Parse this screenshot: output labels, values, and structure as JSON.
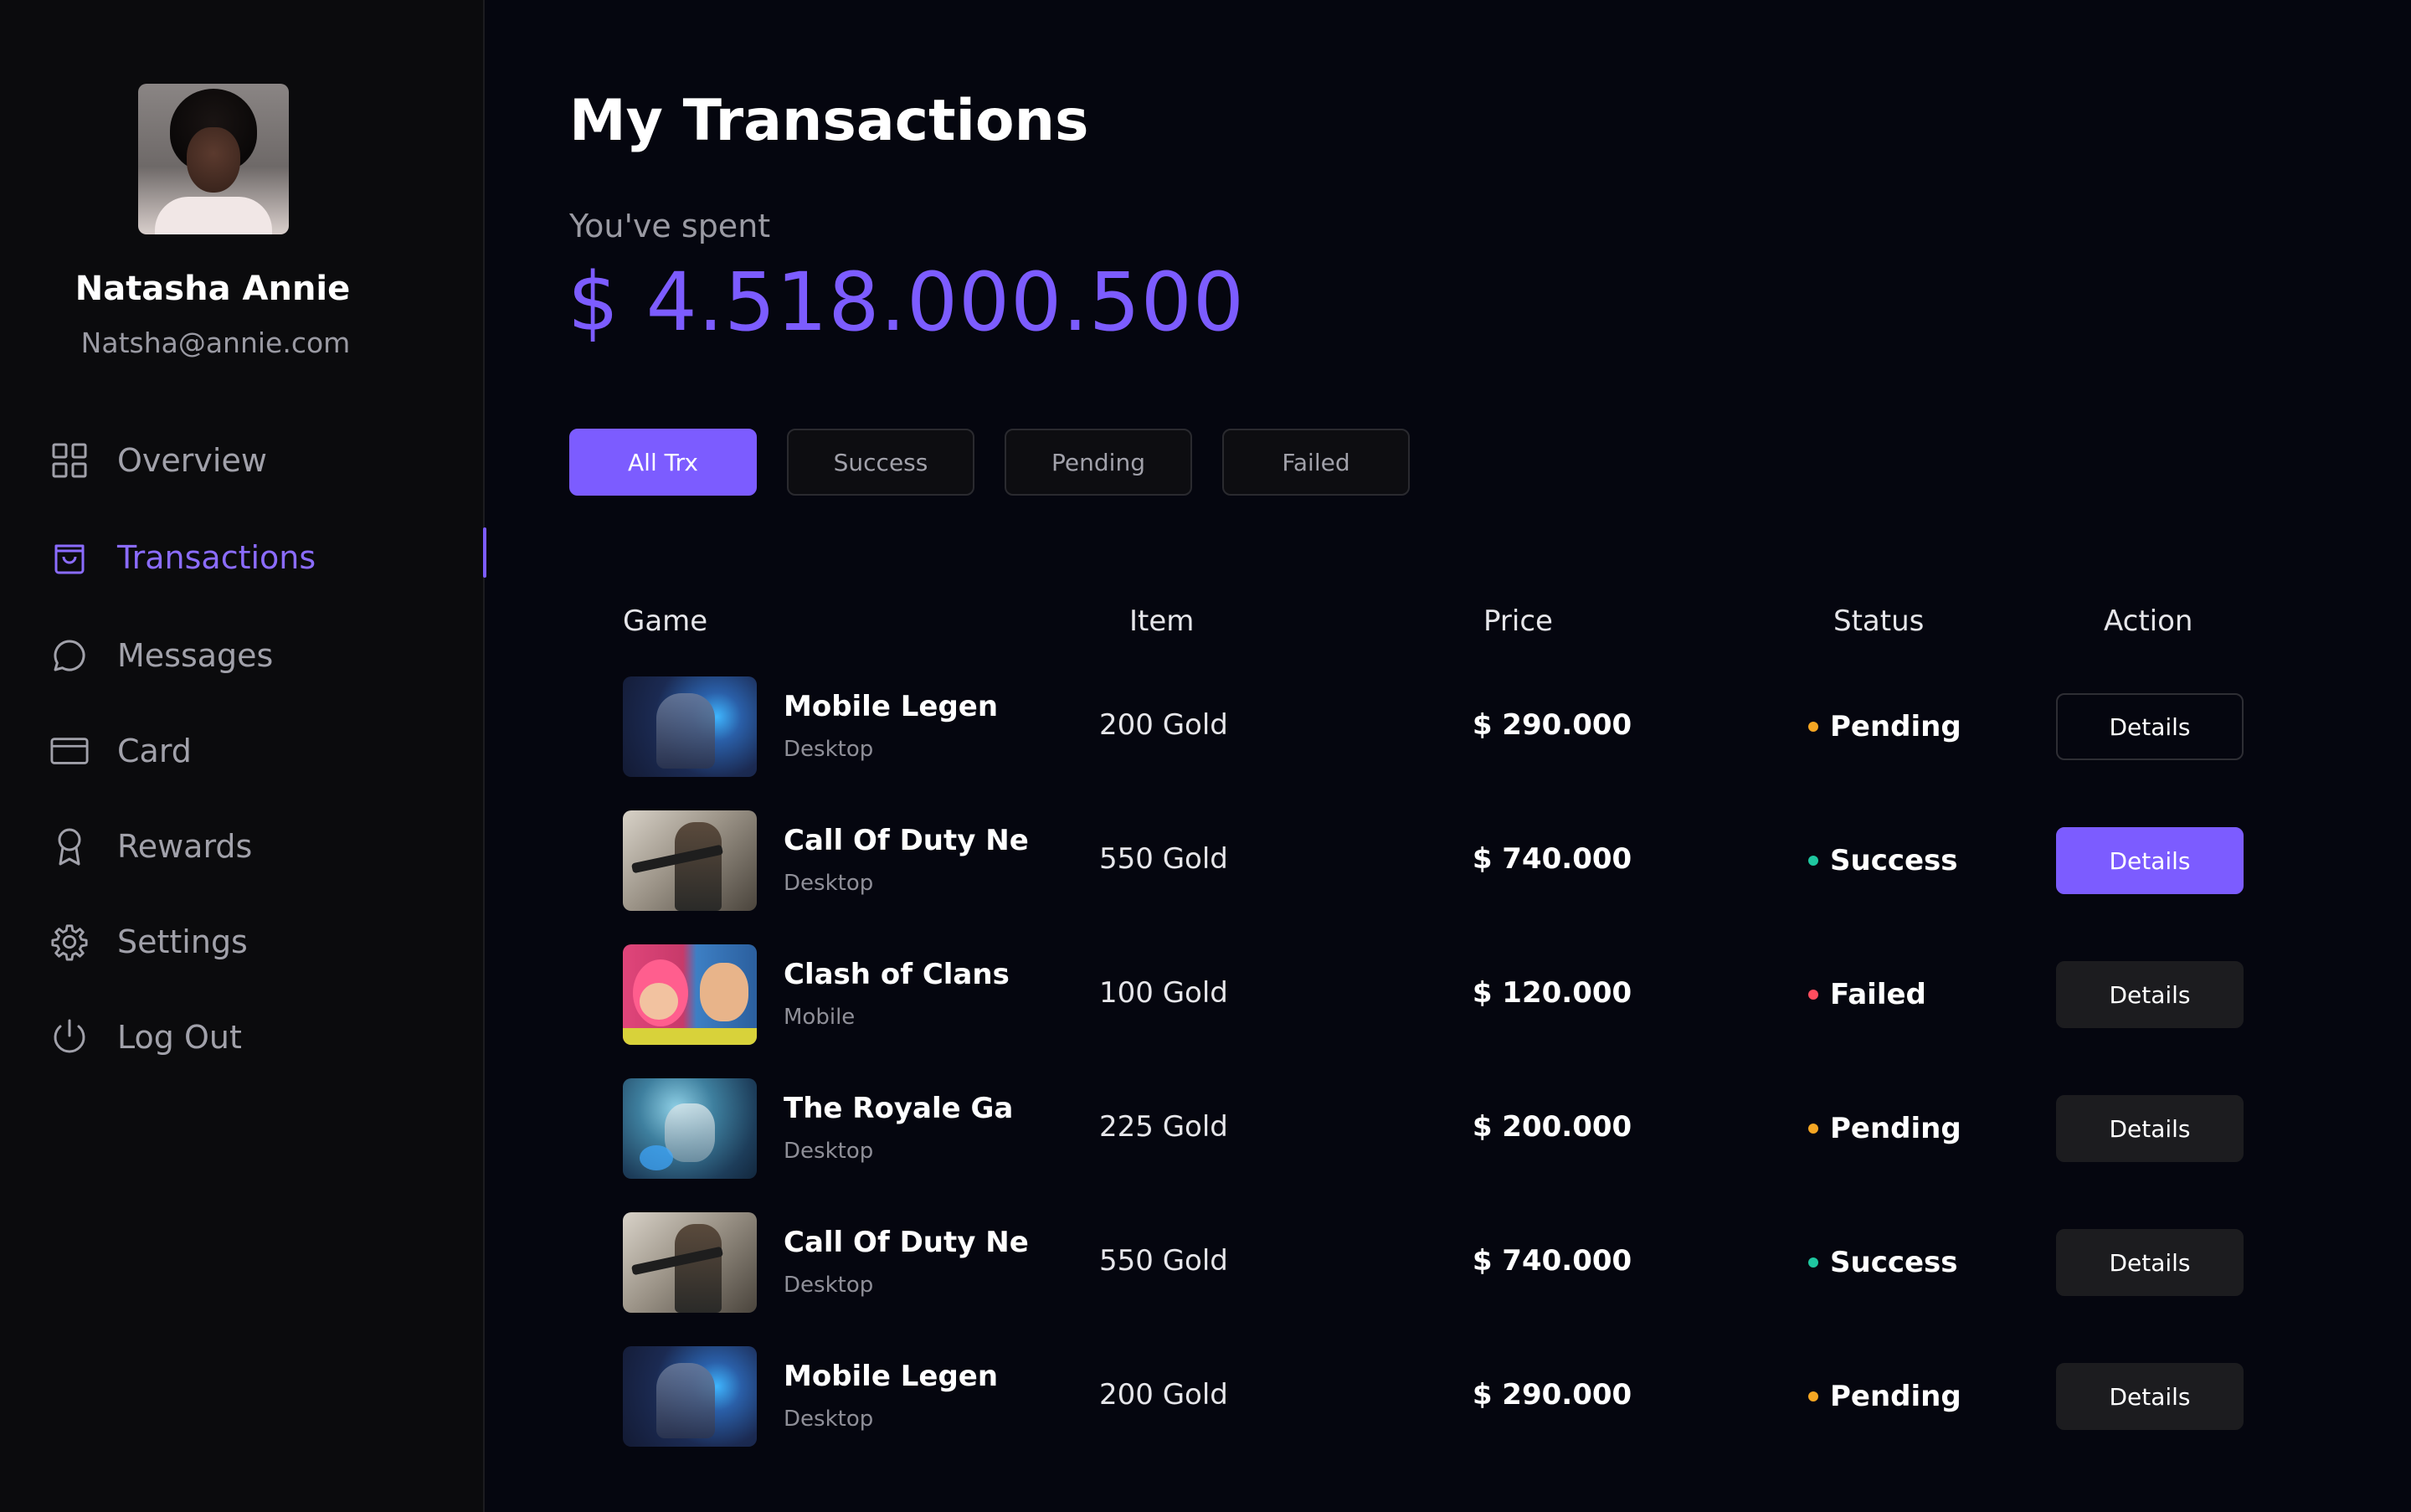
{
  "profile": {
    "name": "Natasha Annie",
    "email": "Natsha@annie.com"
  },
  "nav": {
    "items": [
      {
        "label": "Overview",
        "icon": "grid-icon"
      },
      {
        "label": "Transactions",
        "icon": "bag-icon",
        "active": true
      },
      {
        "label": "Messages",
        "icon": "chat-icon"
      },
      {
        "label": "Card",
        "icon": "card-icon"
      },
      {
        "label": "Rewards",
        "icon": "award-icon"
      },
      {
        "label": "Settings",
        "icon": "gear-icon"
      },
      {
        "label": "Log Out",
        "icon": "power-icon"
      }
    ]
  },
  "main": {
    "title": "My Transactions",
    "spent_label": "You've spent",
    "spent_amount": "$ 4.518.000.500"
  },
  "filters": [
    "All Trx",
    "Success",
    "Pending",
    "Failed"
  ],
  "table": {
    "headers": [
      "Game",
      "Item",
      "Price",
      "Status",
      "Action"
    ],
    "rows": [
      {
        "game": "Mobile Legen",
        "platform": "Desktop",
        "item": "200 Gold",
        "price": "$ 290.000",
        "status": "Pending",
        "action": "Details"
      },
      {
        "game": "Call Of Duty Ne",
        "platform": "Desktop",
        "item": "550 Gold",
        "price": "$ 740.000",
        "status": "Success",
        "action": "Details"
      },
      {
        "game": "Clash of Clans",
        "platform": "Mobile",
        "item": "100 Gold",
        "price": "$ 120.000",
        "status": "Failed",
        "action": "Details"
      },
      {
        "game": "The Royale Ga",
        "platform": "Desktop",
        "item": "225 Gold",
        "price": "$ 200.000",
        "status": "Pending",
        "action": "Details"
      },
      {
        "game": "Call Of Duty Ne",
        "platform": "Desktop",
        "item": "550 Gold",
        "price": "$ 740.000",
        "status": "Success",
        "action": "Details"
      },
      {
        "game": "Mobile Legen",
        "platform": "Desktop",
        "item": "200 Gold",
        "price": "$ 290.000",
        "status": "Pending",
        "action": "Details"
      }
    ]
  },
  "colors": {
    "accent": "#7c5cff",
    "pending": "#f5a623",
    "success": "#1fc7a0",
    "failed": "#ff4d5e",
    "background": "#05060f",
    "sidebar": "#0b0b0d"
  }
}
